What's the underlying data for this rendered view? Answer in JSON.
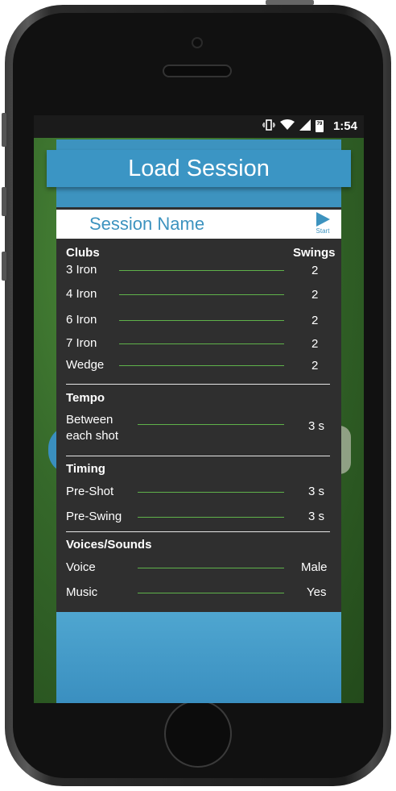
{
  "status_bar": {
    "battery": "79",
    "time": "1:54"
  },
  "dialog": {
    "title": "Load Session",
    "session_name": "Session Name",
    "start_label": "Start",
    "clubs_header": "Clubs",
    "swings_header": "Swings",
    "clubs": [
      {
        "name": "3 Iron",
        "swings": "2"
      },
      {
        "name": "4 Iron",
        "swings": "2"
      },
      {
        "name": "6 Iron",
        "swings": "2"
      },
      {
        "name": "7 Iron",
        "swings": "2"
      },
      {
        "name": "Wedge",
        "swings": "2"
      }
    ],
    "tempo": {
      "header": "Tempo",
      "label_line1": "Between",
      "label_line2": "each shot",
      "value": "3 s"
    },
    "timing": {
      "header": "Timing",
      "items": [
        {
          "label": "Pre-Shot",
          "value": "3 s"
        },
        {
          "label": "Pre-Swing",
          "value": "3 s"
        }
      ]
    },
    "voices": {
      "header": "Voices/Sounds",
      "items": [
        {
          "label": "Voice",
          "value": "Male"
        },
        {
          "label": "Music",
          "value": "Yes"
        }
      ]
    }
  },
  "colors": {
    "accent": "#3d93bf",
    "panel": "#2f2f2f",
    "slider_line": "#5fb24a"
  }
}
